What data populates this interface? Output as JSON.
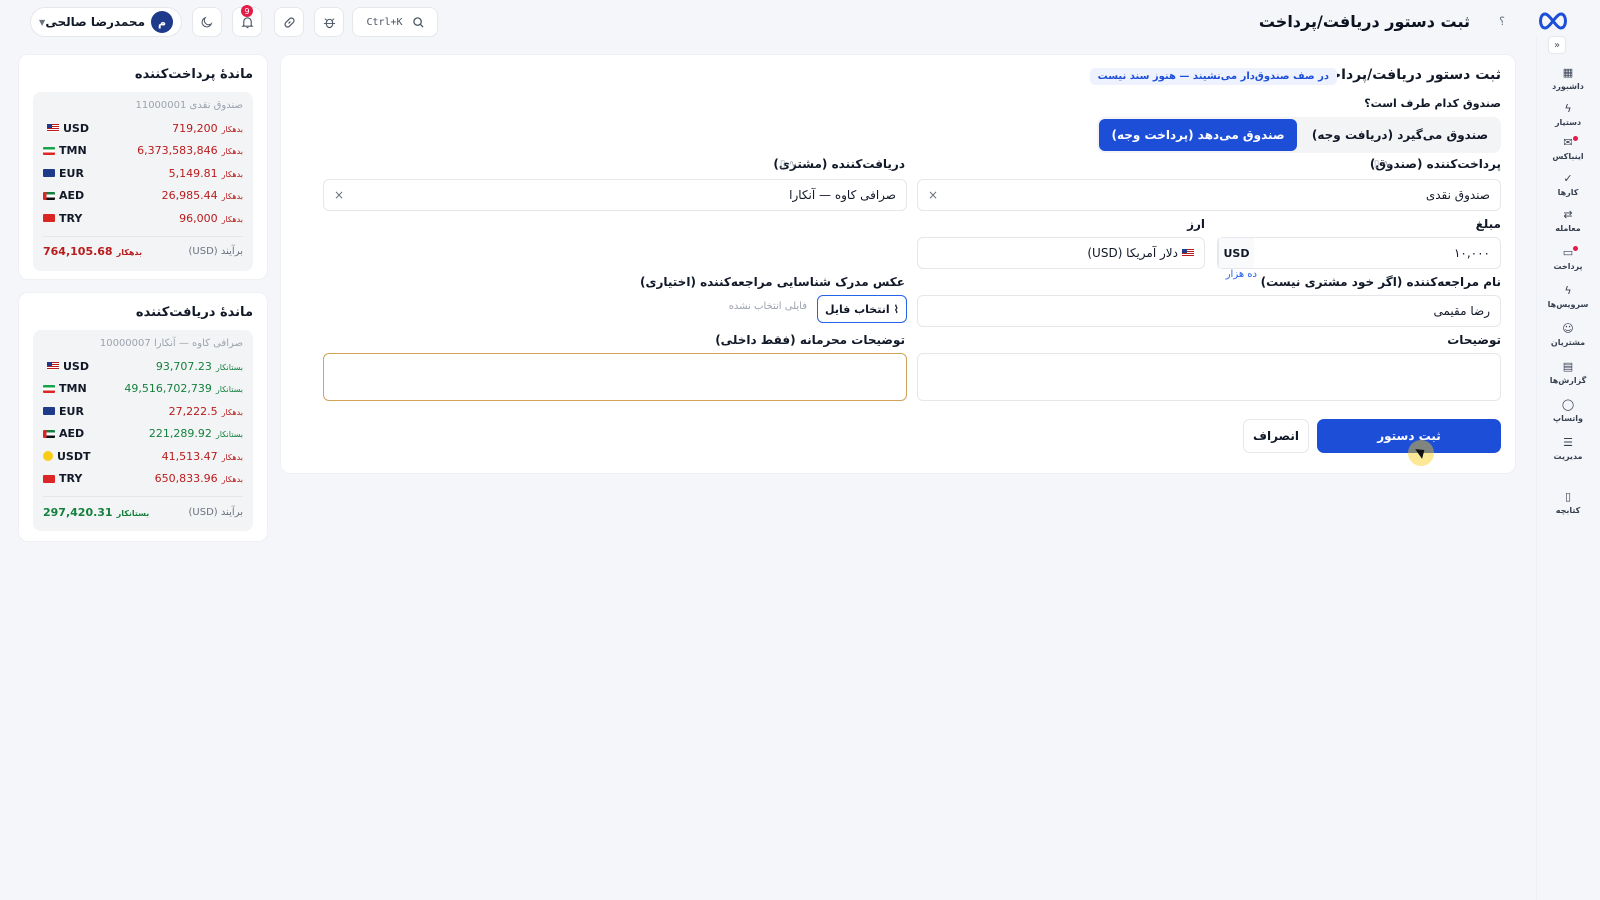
{
  "header": {
    "title": "ثبت دستور دریافت/پرداخت",
    "help": "؟",
    "search_shortcut": "Ctrl+K",
    "notifications_count": "9",
    "user_name": "محمدرضا صالحی",
    "user_initial": "م"
  },
  "nav": {
    "items": [
      {
        "label": "داشبورد",
        "icon": "grid-icon"
      },
      {
        "label": "دستیار",
        "icon": "bolt-icon"
      },
      {
        "label": "اینباکس",
        "icon": "inbox-icon"
      },
      {
        "label": "کارها",
        "icon": "check-icon"
      },
      {
        "label": "معامله",
        "icon": "swap-icon"
      },
      {
        "label": "پرداخت",
        "icon": "payment-icon"
      },
      {
        "label": "سرویس‌ها",
        "icon": "bolt-icon"
      },
      {
        "label": "مشتریان",
        "icon": "users-icon"
      },
      {
        "label": "گزارش‌ها",
        "icon": "report-icon"
      },
      {
        "label": "واتساپ",
        "icon": "chat-icon"
      },
      {
        "label": "مدیریت",
        "icon": "sliders-icon"
      },
      {
        "label": "کتابچه",
        "icon": "book-icon"
      }
    ]
  },
  "form": {
    "title": "ثبت دستور دریافت/پرداخت",
    "queue_note": "در صف صندوق‌دار می‌نشیند — هنوز سند نیست",
    "side_question": "صندوق کدام طرف است؟",
    "tab_receive": "صندوق می‌گیرد (دریافت وجه)",
    "tab_pay": "صندوق می‌دهد (پرداخت وجه)",
    "payer_label": "پرداخت‌کننده (صندوق)",
    "payer_value": "صندوق نقدی",
    "payee_label": "دریافت‌کننده (مشتری)",
    "payee_value": "صرافی کاوه — آنکارا",
    "amount_label": "مبلغ",
    "amount_value": "۱۰,۰۰۰",
    "amount_currency": "USD",
    "amount_hint": "ده هزار",
    "currency_label": "ارز",
    "currency_value": "دلار آمریکا (USD)",
    "referrer_label": "نام مراجعه‌کننده (اگر خود مشتری نیست)",
    "referrer_value": "رضا مقیمی",
    "doc_label": "عکس مدرک شناسایی مراجعه‌کننده (اختیاری)",
    "file_button": "انتخاب فایل",
    "file_status": "فایلی انتخاب نشده",
    "notes_label": "توضیحات",
    "private_label": "توضیحات محرمانه (فقط داخلی)",
    "submit": "ثبت دستور",
    "cancel": "انصراف"
  },
  "payer_balance": {
    "title": "ماندهٔ پرداخت‌کننده",
    "account": "صندوق نقدی 11000001",
    "rows": [
      {
        "cur": "USD",
        "amount": "719,200",
        "status": "بدهکار",
        "type": "debit"
      },
      {
        "cur": "TMN",
        "amount": "6,373,583,846",
        "status": "بدهکار",
        "type": "debit"
      },
      {
        "cur": "EUR",
        "amount": "5,149.81",
        "status": "بدهکار",
        "type": "debit"
      },
      {
        "cur": "AED",
        "amount": "26,985.44",
        "status": "بدهکار",
        "type": "debit"
      },
      {
        "cur": "TRY",
        "amount": "96,000",
        "status": "بدهکار",
        "type": "debit"
      }
    ],
    "total_label": "برآیند (USD)",
    "total_amount": "764,105.68",
    "total_status": "بدهکار"
  },
  "payee_balance": {
    "title": "ماندهٔ دریافت‌کننده",
    "account": "صرافی کاوه — آنکارا 10000007",
    "rows": [
      {
        "cur": "USD",
        "amount": "93,707.23",
        "status": "بستانکار",
        "type": "credit"
      },
      {
        "cur": "TMN",
        "amount": "49,516,702,739",
        "status": "بستانکار",
        "type": "credit"
      },
      {
        "cur": "EUR",
        "amount": "27,222.5",
        "status": "بدهکار",
        "type": "debit"
      },
      {
        "cur": "AED",
        "amount": "221,289.92",
        "status": "بستانکار",
        "type": "credit"
      },
      {
        "cur": "USDT",
        "amount": "41,513.47",
        "status": "بدهکار",
        "type": "debit"
      },
      {
        "cur": "TRY",
        "amount": "650,833.96",
        "status": "بدهکار",
        "type": "debit"
      }
    ],
    "total_label": "برآیند (USD)",
    "total_amount": "297,420.31",
    "total_status": "بستانکار"
  },
  "colors": {
    "accent": "#1d4ed8",
    "debit": "#b91c1c",
    "credit": "#15803d"
  }
}
